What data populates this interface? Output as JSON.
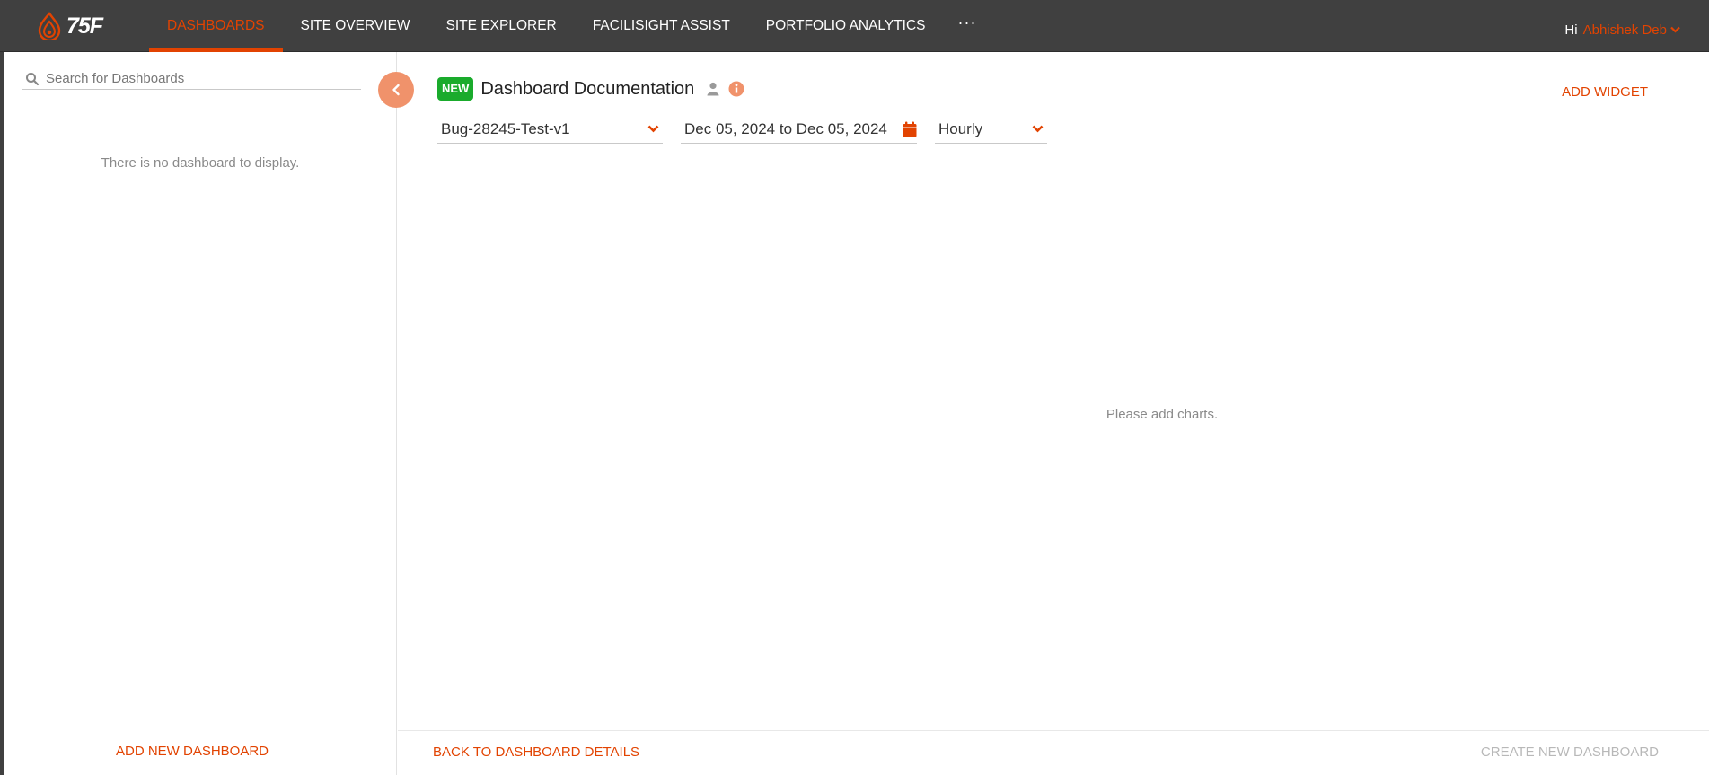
{
  "brand": {
    "logo_text": "75F",
    "accent": "#e24301"
  },
  "nav": {
    "items": [
      {
        "label": "DASHBOARDS",
        "active": true
      },
      {
        "label": "SITE OVERVIEW"
      },
      {
        "label": "SITE EXPLORER"
      },
      {
        "label": "FACILISIGHT ASSIST"
      },
      {
        "label": "PORTFOLIO ANALYTICS"
      }
    ],
    "more": "···"
  },
  "user": {
    "greeting": "Hi",
    "name": "Abhishek Deb"
  },
  "sidebar": {
    "search_placeholder": "Search for Dashboards",
    "empty_message": "There is no dashboard to display.",
    "add_label": "ADD NEW DASHBOARD"
  },
  "dashboard": {
    "badge": "NEW",
    "title": "Dashboard Documentation",
    "add_widget": "ADD WIDGET",
    "site_select": "Bug-28245-Test-v1",
    "date_range": "Dec 05, 2024 to Dec 05, 2024",
    "interval": "Hourly",
    "empty_message": "Please add charts."
  },
  "footer": {
    "back_label": "BACK TO DASHBOARD DETAILS",
    "create_label": "CREATE NEW DASHBOARD"
  }
}
